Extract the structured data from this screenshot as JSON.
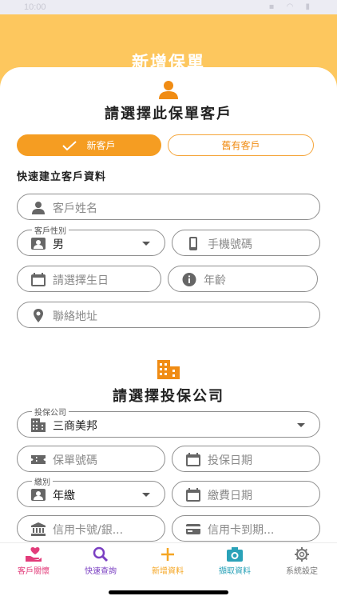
{
  "status": {
    "time": "10:00",
    "icons": "▪ ◠ ▮"
  },
  "header": {
    "title": "新增保單"
  },
  "customer_section": {
    "title": "請選擇此保單客戶",
    "toggle_new": "新客戶",
    "toggle_existing": "舊有客戶",
    "subhead": "快速建立客戶資料",
    "name_placeholder": "客戶姓名",
    "gender_legend": "客戶性別",
    "gender_value": "男",
    "phone_placeholder": "手機號碼",
    "birthday_placeholder": "請選擇生日",
    "age_placeholder": "年齡",
    "address_placeholder": "聯絡地址"
  },
  "company_section": {
    "title": "請選擇投保公司",
    "company_legend": "投保公司",
    "company_value": "三商美邦",
    "policy_no_placeholder": "保單號碼",
    "insure_date_placeholder": "投保日期",
    "payment_legend": "繳別",
    "payment_value": "年繳",
    "payment_date_placeholder": "繳費日期",
    "card_no_placeholder": "信用卡號/銀...",
    "card_expiry_placeholder": "信用卡到期..."
  },
  "nav": {
    "items": [
      {
        "label": "客戶關懷",
        "icon": "heart-hand-icon",
        "color": "#e23c7a"
      },
      {
        "label": "快速查詢",
        "icon": "search-icon",
        "color": "#7a3fc2"
      },
      {
        "label": "新增資料",
        "icon": "plus-icon",
        "color": "#f5a623"
      },
      {
        "label": "擷取資料",
        "icon": "camera-icon",
        "color": "#2aa2b8"
      },
      {
        "label": "系統設定",
        "icon": "gear-icon",
        "color": "#777777"
      }
    ]
  },
  "colors": {
    "header": "#fdc75e",
    "accent": "#f59d22",
    "border": "#8e8e8e"
  }
}
